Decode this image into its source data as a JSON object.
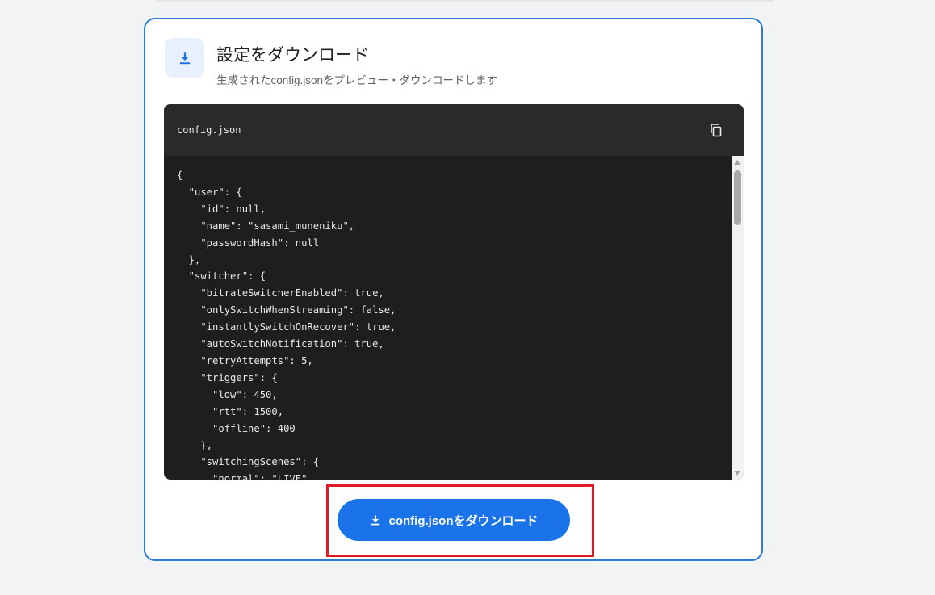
{
  "card": {
    "title": "設定をダウンロード",
    "subtitle": "生成されたconfig.jsonをプレビュー・ダウンロードします",
    "icon": "download-icon"
  },
  "code_panel": {
    "filename": "config.json",
    "copy_icon": "copy-icon",
    "content": "{\n  \"user\": {\n    \"id\": null,\n    \"name\": \"sasami_muneniku\",\n    \"passwordHash\": null\n  },\n  \"switcher\": {\n    \"bitrateSwitcherEnabled\": true,\n    \"onlySwitchWhenStreaming\": false,\n    \"instantlySwitchOnRecover\": true,\n    \"autoSwitchNotification\": true,\n    \"retryAttempts\": 5,\n    \"triggers\": {\n      \"low\": 450,\n      \"rtt\": 1500,\n      \"offline\": 400\n    },\n    \"switchingScenes\": {\n      \"normal\": \"LIVE\""
  },
  "download_button": {
    "label": "config.jsonをダウンロード",
    "icon": "download-icon"
  },
  "colors": {
    "accent": "#1a73e8",
    "card_border": "#2b7bd6",
    "highlight": "#e01b24",
    "code_bg": "#1e1e1e"
  }
}
